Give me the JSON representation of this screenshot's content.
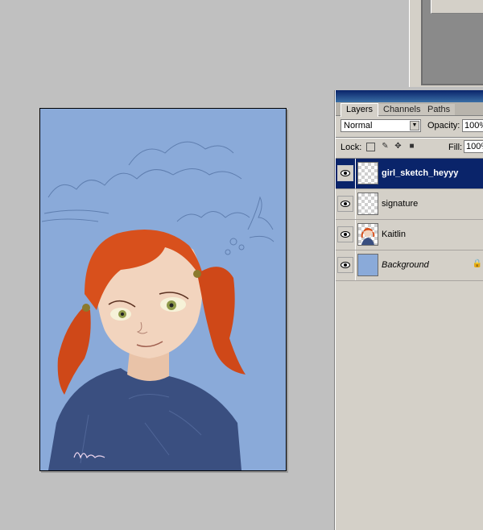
{
  "palette": {
    "tabs": [
      {
        "label": "Layers"
      },
      {
        "label": "Channels"
      },
      {
        "label": "Paths"
      }
    ],
    "blend_mode": "Normal",
    "opacity_label": "Opacity:",
    "opacity_value": "100%",
    "lock_label": "Lock:",
    "fill_label": "Fill:",
    "fill_value": "100%",
    "layers": [
      {
        "name": "girl_sketch_heyyy",
        "selected": true
      },
      {
        "name": "signature",
        "selected": false
      },
      {
        "name": "Kaitlin",
        "selected": false
      },
      {
        "name": "Background",
        "selected": false,
        "locked": true
      }
    ]
  },
  "colors": {
    "canvas_bg": "#8aaad9",
    "hair": "#d8501c",
    "shirt": "#3a4f80",
    "selection": "#0a246a"
  },
  "icons": [
    "eye-icon",
    "lock-transparent-icon",
    "lock-brush-icon",
    "lock-move-icon",
    "lock-all-icon",
    "padlock-icon",
    "dropdown-arrow-icon"
  ]
}
